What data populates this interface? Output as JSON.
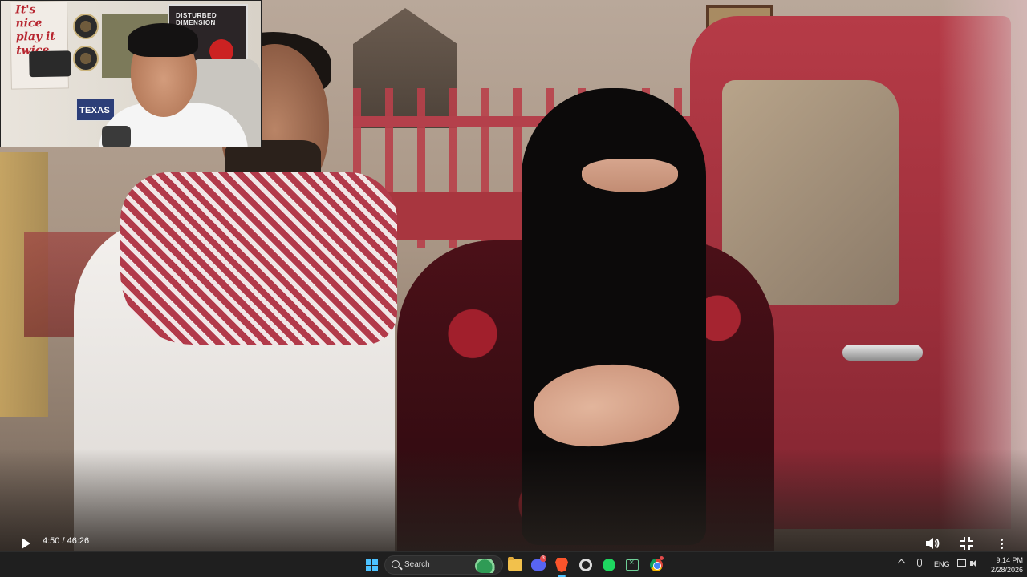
{
  "player": {
    "time": "4:50 / 46:26",
    "icons": {
      "play": "play-icon",
      "volume": "volume-icon",
      "exit_fullscreen": "exit-fullscreen-icon",
      "more": "more-vertical-icon"
    }
  },
  "webcam": {
    "poster_text": "It's nice play it twice",
    "poster_right_title": "DISTURBED DIMENSION",
    "sign_text": "TEXAS"
  },
  "taskbar": {
    "search_label": "Search",
    "apps": [
      "start",
      "file-explorer",
      "discord",
      "brave",
      "obs",
      "spotify",
      "xbox",
      "chrome"
    ],
    "discord_badge": "3",
    "tray": {
      "language": "ENG",
      "time": "9:14 PM",
      "date": "2/28/2026"
    }
  },
  "colors": {
    "taskbar_bg": "#1f1f1f",
    "accent": "#4cc2ff"
  }
}
